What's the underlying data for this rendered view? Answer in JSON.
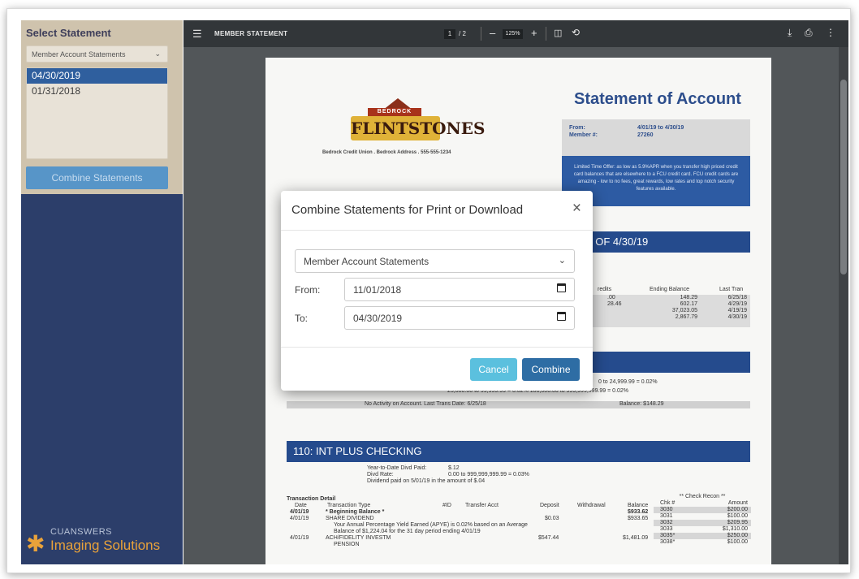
{
  "sidebar": {
    "title": "Select Statement",
    "dropdown_value": "Member Account Statements",
    "dates": [
      "04/30/2019",
      "01/31/2018"
    ],
    "combine_label": "Combine Statements",
    "brand_top": "CUANSWERS",
    "brand_bottom": "Imaging Solutions"
  },
  "viewer": {
    "title": "MEMBER STATEMENT",
    "page_current": "1",
    "page_total": "/ 2",
    "zoom": "125%",
    "icons": [
      "menu-icon",
      "zoom-out-icon",
      "zoom-in-icon",
      "fit-page-icon",
      "rotate-icon",
      "download-icon",
      "print-icon",
      "more-icon"
    ]
  },
  "document": {
    "logo_banner": "BEDROCK",
    "logo_word": "FLINTSTONES",
    "address": "Bedrock Credit Union . Bedrock Address . 555-555-1234",
    "soa_title": "Statement of Account",
    "from_label": "From:",
    "from_value": "4/01/19 to 4/30/19",
    "member_label": "Member #:",
    "member_value": "27260",
    "promo": "Limited Time Offer: as low as 5.9%APR when you transfer high priced credit card balances that are elsewhere to a FCU credit card. FCU credit cards are amazing - low to no fees, great rewards, low rates and top notch security features available.",
    "section1_partial": "D AS OF 4/30/19",
    "col_credits": "redits",
    "col_balance": "Ending Balance",
    "col_last": "Last Tran",
    "rows": [
      {
        "credits": ".00",
        "balance": "148.29",
        "last": "6/25/18"
      },
      {
        "credits": "28.46",
        "balance": "602.17",
        "last": "4/29/19"
      },
      {
        "credits": "",
        "balance": "37,023.05",
        "last": "4/19/19"
      },
      {
        "credits": "",
        "balance": "2,867.79",
        "last": "4/30/19"
      }
    ],
    "rates_line1": "0 to        24,999.99 =  0.02%",
    "rates_line2": "25,000.00  to  99,999.99 =  0.02%    100,000.00  to  999,999,999.99 =  0.02%",
    "no_activity": "No Activity on Account. Last Trans Date: 6/25/18",
    "no_activity_balance": "Balance: $148.29",
    "section110": "110: INT PLUS CHECKING",
    "ytd_label": "Year-to-Date Divd Paid:",
    "ytd_value": "$.12",
    "divd_rate_label": "Divd Rate:",
    "divd_rate_value": "0.00  to  999,999,999.99 =  0.03%",
    "dividend_note": "Dividend paid on 5/01/19 in the amount of $.04",
    "txn_title": "Transaction Detail",
    "txn_headers": [
      "Date",
      "Transaction Type",
      "#ID",
      "Transfer Acct",
      "Deposit",
      "Withdrawal",
      "Balance"
    ],
    "txns": [
      {
        "date": "4/01/19",
        "type": "* Beginning Balance *",
        "deposit": "",
        "balance": "$933.62"
      },
      {
        "date": "4/01/19",
        "type": "SHARE DIVIDEND",
        "deposit": "$0.03",
        "balance": "$933.65"
      },
      {
        "date": "",
        "type": "Your Annual Percentage Yield Earned (APYE) is 0.02% based on an Average",
        "deposit": "",
        "balance": ""
      },
      {
        "date": "",
        "type": "Balance of $1,224.04 for the 31 day period ending 4/01/19",
        "deposit": "",
        "balance": ""
      },
      {
        "date": "4/01/19",
        "type": "ACH/FIDELITY INVESTM",
        "deposit": "$547.44",
        "balance": "$1,481.09"
      },
      {
        "date": "",
        "type": "PENSION",
        "deposit": "",
        "balance": ""
      }
    ],
    "check_title": "** Check Recon **",
    "check_headers": [
      "Chk #",
      "Amount"
    ],
    "checks": [
      {
        "num": "3030",
        "amount": "$200.00"
      },
      {
        "num": "3031",
        "amount": "$100.00"
      },
      {
        "num": "3032",
        "amount": "$209.95"
      },
      {
        "num": "3033",
        "amount": "$1,310.00"
      },
      {
        "num": "3035*",
        "amount": "$250.00"
      },
      {
        "num": "3038*",
        "amount": "$100.00"
      }
    ]
  },
  "modal": {
    "title": "Combine Statements for Print or Download",
    "close_glyph": "×",
    "select_value": "Member Account Statements",
    "from_label": "From:",
    "from_value": "11/01/2018",
    "to_label": "To:",
    "to_value": "04/30/2019",
    "cancel_label": "Cancel",
    "combine_label": "Combine"
  },
  "colors": {
    "sidebar_bg": "#2c3e6a",
    "select_panel_bg": "#cfc3ad",
    "selected_date": "#2f5f9e",
    "cancel_btn": "#5bc0de",
    "combine_btn": "#2e6da4",
    "section_bar": "#254b8d"
  }
}
